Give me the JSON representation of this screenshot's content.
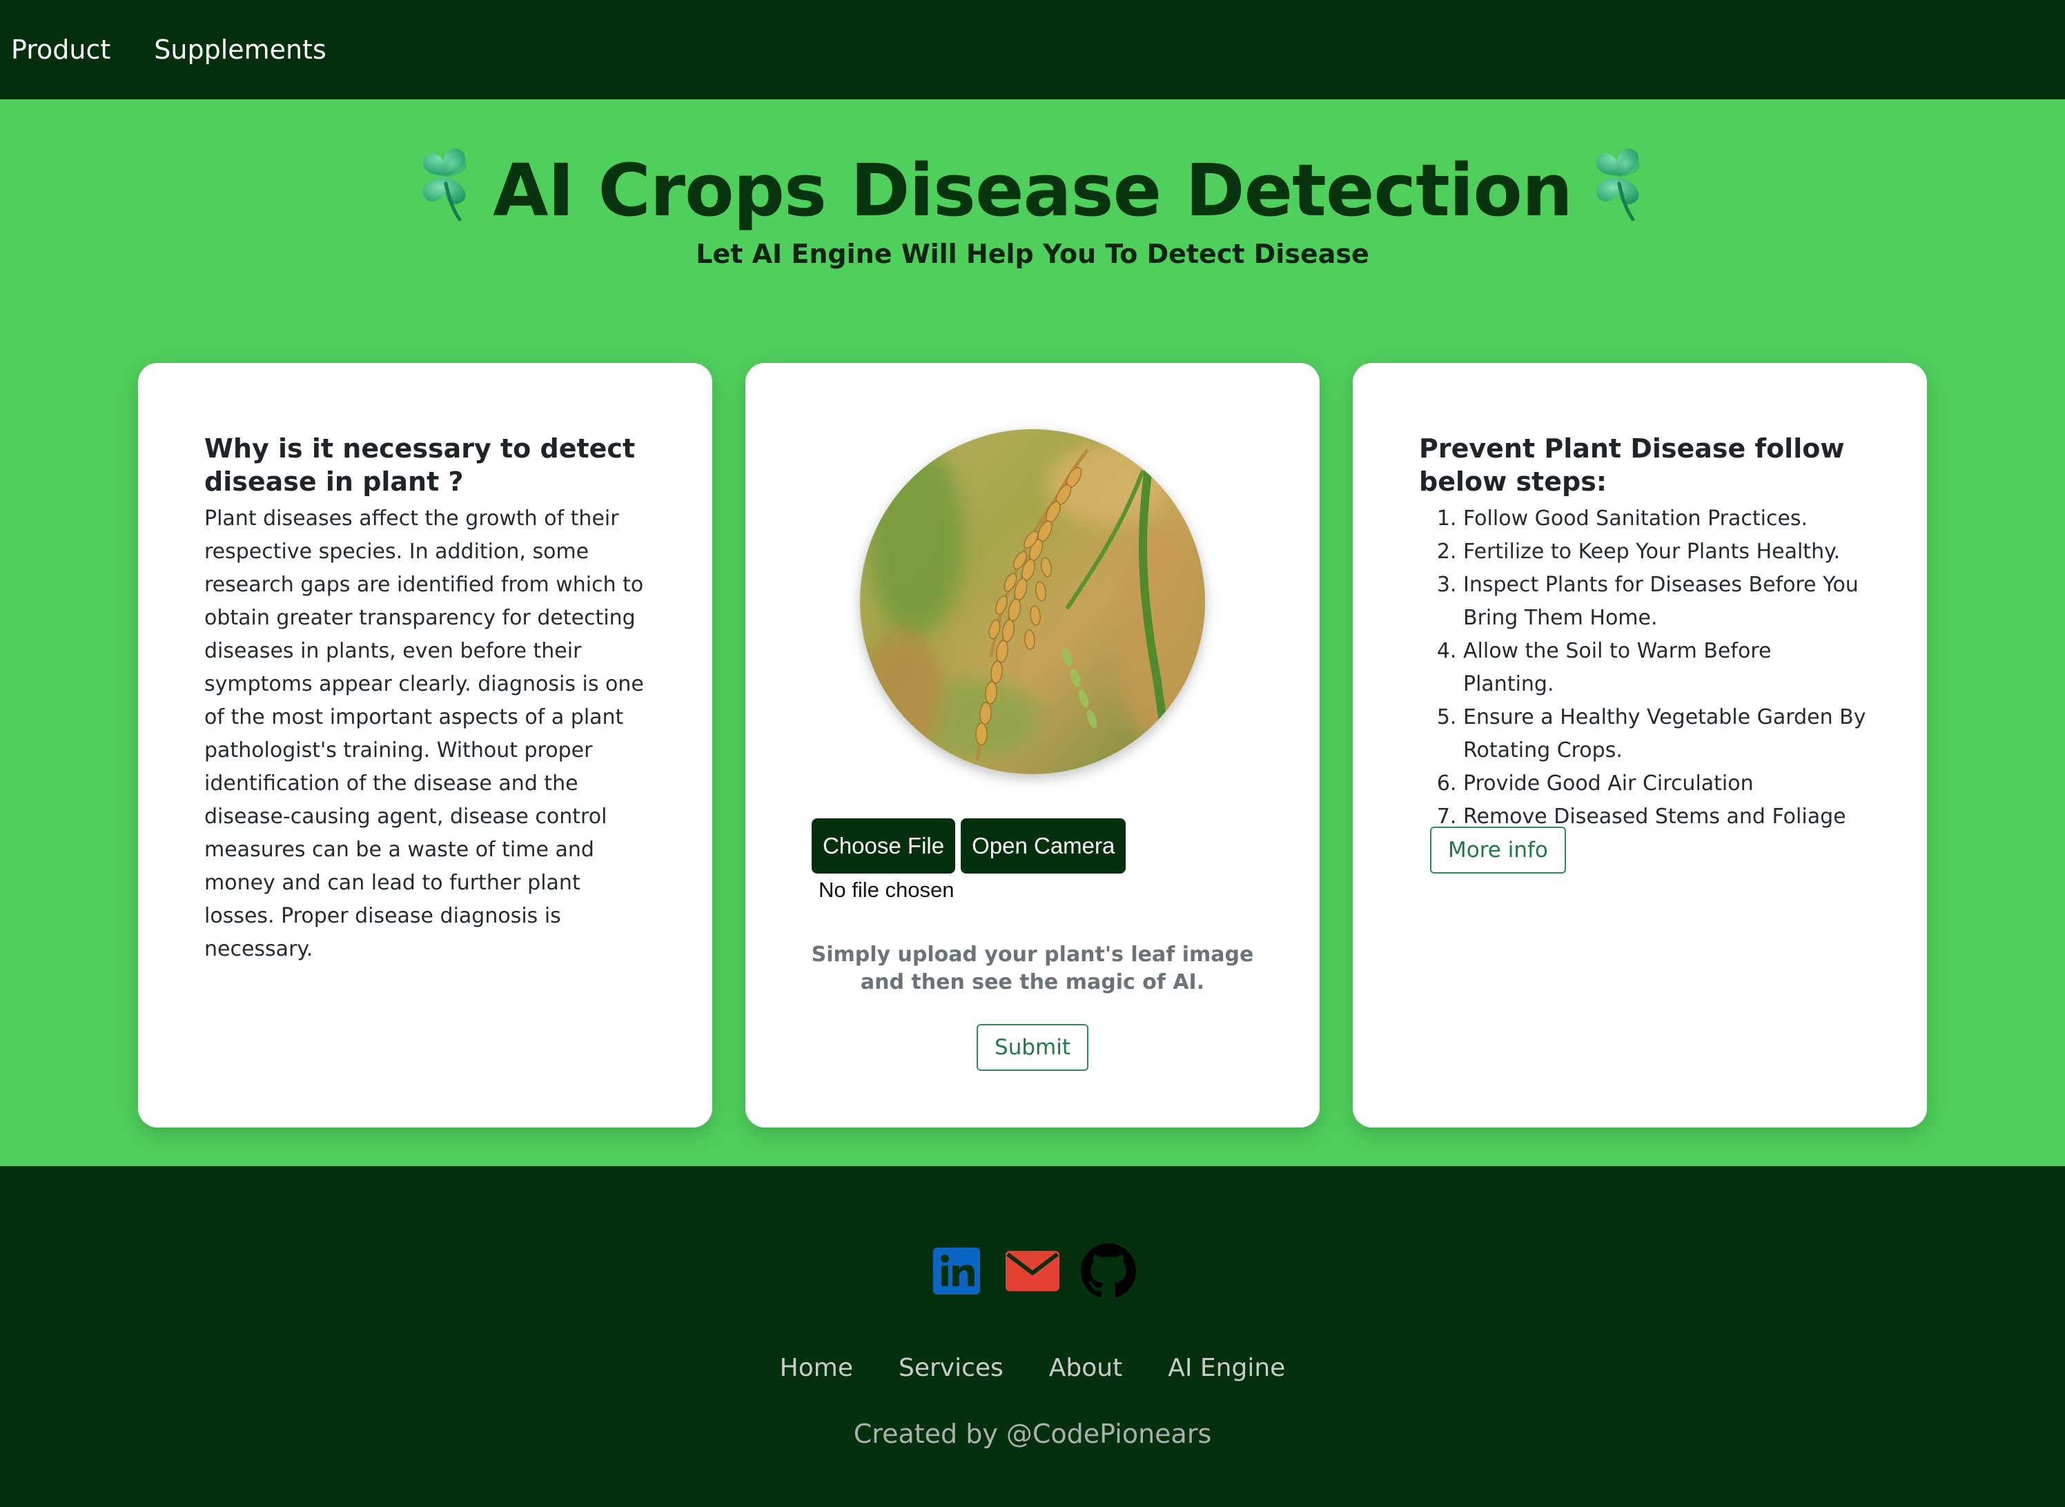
{
  "nav": {
    "items": [
      {
        "label": "Product"
      },
      {
        "label": "Supplements"
      }
    ]
  },
  "hero": {
    "title": "AI Crops Disease Detection",
    "subtitle": "Let AI Engine Will Help You To Detect Disease",
    "decoration_icon": "four-leaf-clover-icon"
  },
  "why_card": {
    "heading": "Why is it necessary to detect disease in plant ?",
    "body": "Plant diseases affect the growth of their respective species. In addition, some research gaps are identified from which to obtain greater transparency for detecting diseases in plants, even before their symptoms appear clearly. diagnosis is one of the most important aspects of a plant pathologist's training. Without proper identification of the disease and the disease-causing agent, disease control measures can be a waste of time and money and can lead to further plant losses. Proper disease diagnosis is necessary."
  },
  "upload_card": {
    "choose_file_label": "Choose File",
    "open_camera_label": "Open Camera",
    "file_status": "No file chosen",
    "hint": "Simply upload your plant's leaf image and then see the magic of AI.",
    "submit_label": "Submit"
  },
  "prevent_card": {
    "heading": "Prevent Plant Disease follow below steps:",
    "steps": [
      "Follow Good Sanitation Practices.",
      "Fertilize to Keep Your Plants Healthy.",
      "Inspect Plants for Diseases Before You Bring Them Home.",
      "Allow the Soil to Warm Before Planting.",
      "Ensure a Healthy Vegetable Garden By Rotating Crops.",
      "Provide Good Air Circulation",
      "Remove Diseased Stems and Foliage"
    ],
    "more_info_label": "More info"
  },
  "footer": {
    "social": [
      {
        "icon": "linkedin-icon",
        "color": "#0a66c2"
      },
      {
        "icon": "mail-icon",
        "color": "#e34133"
      },
      {
        "icon": "github-icon",
        "color": "#000000"
      }
    ],
    "links": [
      {
        "label": "Home"
      },
      {
        "label": "Services"
      },
      {
        "label": "About"
      },
      {
        "label": "AI Engine"
      }
    ],
    "credit": "Created by @CodePionears"
  },
  "colors": {
    "nav_bg": "#04300e",
    "page_bg": "#4fcf5c",
    "title": "#07330e",
    "accent_outline": "#2e8b57"
  }
}
